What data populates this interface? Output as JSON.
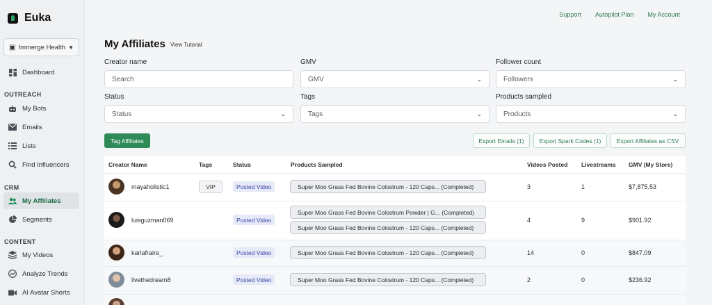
{
  "brand": {
    "name": "Euka"
  },
  "workspace": {
    "label": "Immerge Health"
  },
  "sidebar": {
    "dashboard": "Dashboard",
    "sections": {
      "outreach": "OUTREACH",
      "crm": "CRM",
      "content": "CONTENT"
    },
    "outreach_items": [
      "My Bots",
      "Emails",
      "Lists",
      "Find Influencers"
    ],
    "crm_items": [
      "My Affiliates",
      "Segments"
    ],
    "content_items": [
      "My Videos",
      "Analyze Trends",
      "AI Avatar Shorts"
    ]
  },
  "toplinks": [
    "Support",
    "Autopilot Plan",
    "My Account"
  ],
  "page": {
    "title": "My Affiliates",
    "tutorial": "View Tutorial"
  },
  "filters": {
    "creator_name": {
      "label": "Creator name",
      "placeholder": "Search"
    },
    "gmv": {
      "label": "GMV",
      "value": "GMV"
    },
    "follower_count": {
      "label": "Follower count",
      "value": "Followers"
    },
    "status": {
      "label": "Status",
      "value": "Status"
    },
    "tags": {
      "label": "Tags",
      "value": "Tags"
    },
    "products_sampled": {
      "label": "Products sampled",
      "value": "Products"
    }
  },
  "actions": {
    "tag_affiliates": "Tag Affiliates",
    "export_emails": "Export Emails (1)",
    "export_spark": "Export Spark Codes (1)",
    "export_csv": "Export Affiliates as CSV"
  },
  "table": {
    "headers": [
      "Creator Name",
      "Tags",
      "Status",
      "Products Sampled",
      "Videos Posted",
      "Livestreams",
      "GMV (My Store)"
    ],
    "rows": [
      {
        "name": "mayaholistic1",
        "tag": "VIP",
        "status": "Posted Video",
        "products": [
          "Super Moo Grass Fed Bovine Colostrum - 120 Caps... (Completed)"
        ],
        "videos": "3",
        "livestreams": "1",
        "gmv": "$7,875.53"
      },
      {
        "name": "luisguzman069",
        "tag": "",
        "status": "Posted Video",
        "products": [
          "Super Moo Grass Fed Bovine Colostrum Powder | G... (Completed)",
          "Super Moo Grass Fed Bovine Colostrum - 120 Caps... (Completed)"
        ],
        "videos": "4",
        "livestreams": "9",
        "gmv": "$901.92"
      },
      {
        "name": "karlafraire_",
        "tag": "",
        "status": "Posted Video",
        "products": [
          "Super Moo Grass Fed Bovine Colostrum - 120 Caps... (Completed)"
        ],
        "videos": "14",
        "livestreams": "0",
        "gmv": "$847.09"
      },
      {
        "name": "livethedream8",
        "tag": "",
        "status": "Posted Video",
        "products": [
          "Super Moo Grass Fed Bovine Colostrum - 120 Caps... (Completed)"
        ],
        "videos": "2",
        "livestreams": "0",
        "gmv": "$236.92"
      }
    ]
  },
  "colors": {
    "accent": "#2e8b57",
    "status_bg": "#e6e9f7",
    "status_text": "#3c4aa8"
  },
  "icons": {
    "dashboard": "dashboard-icon",
    "bots": "robot-icon",
    "emails": "mail-icon",
    "lists": "list-icon",
    "find": "search-icon",
    "affiliates": "users-icon",
    "segments": "pie-icon",
    "videos": "layers-icon",
    "trends": "trend-icon",
    "avatar": "video-camera-icon"
  }
}
